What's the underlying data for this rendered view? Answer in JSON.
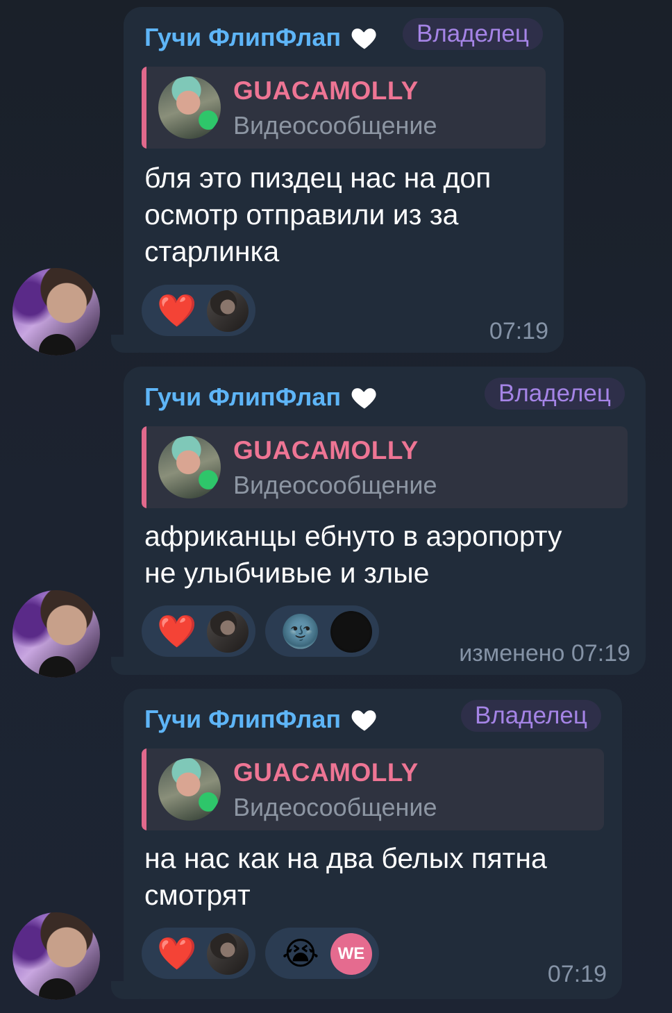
{
  "messages": [
    {
      "sender": "Гучи ФлипФлап",
      "role": "Владелец",
      "reply": {
        "name": "GUACAMOLLY",
        "type": "Видеосообщение"
      },
      "text": [
        "бля это пиздец нас на доп",
        "осмотр отправили из за",
        "старлинка"
      ],
      "reactions": [
        {
          "emoji": "❤️",
          "icon": "heart-reaction"
        }
      ],
      "time": "07:19"
    },
    {
      "sender": "Гучи ФлипФлап",
      "role": "Владелец",
      "reply": {
        "name": "GUACAMOLLY",
        "type": "Видеосообщение"
      },
      "text": [
        "африканцы ебнуто в аэропорту",
        "не улыбчивые и злые"
      ],
      "reactions": [
        {
          "emoji": "❤️",
          "icon": "heart-reaction"
        },
        {
          "emoji": "🌚",
          "icon": "moon-face-reaction"
        }
      ],
      "time": "изменено 07:19"
    },
    {
      "sender": "Гучи ФлипФлап",
      "role": "Владелец",
      "reply": {
        "name": "GUACAMOLLY",
        "type": "Видеосообщение"
      },
      "text": [
        "на нас как на два белых пятна",
        "смотрят"
      ],
      "reactions": [
        {
          "emoji": "❤️",
          "icon": "heart-reaction"
        },
        {
          "emoji": "😭",
          "icon": "crying-face-reaction",
          "reactor_initials": "WE"
        }
      ],
      "time": "07:19"
    }
  ],
  "colors": {
    "sender": "#5eb5f7",
    "role": "#a584e6",
    "reply_name": "#ee7594",
    "bubble": "#212c3a",
    "reaction_bg": "#2b3c52"
  }
}
